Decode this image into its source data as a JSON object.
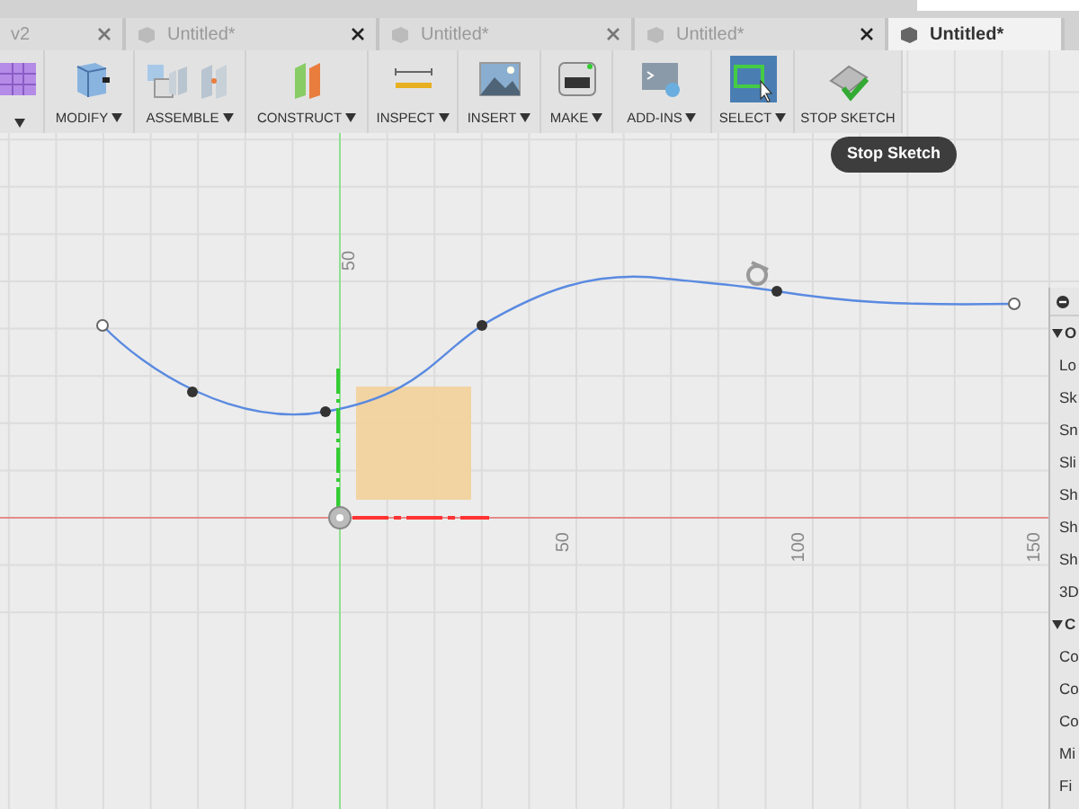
{
  "tabs": [
    {
      "label": "v2",
      "selected": false
    },
    {
      "label": "Untitled*",
      "selected": false
    },
    {
      "label": "Untitled*",
      "selected": false
    },
    {
      "label": "Untitled*",
      "selected": false
    },
    {
      "label": "Untitled*",
      "selected": true
    }
  ],
  "toolbar": [
    {
      "dropdown": true,
      "selected": false
    },
    {
      "label": "MODIFY",
      "dropdown": true,
      "selected": false
    },
    {
      "label": "ASSEMBLE",
      "dropdown": true,
      "selected": false
    },
    {
      "label": "CONSTRUCT",
      "dropdown": true,
      "selected": false
    },
    {
      "label": "INSPECT",
      "dropdown": true,
      "selected": false
    },
    {
      "label": "INSERT",
      "dropdown": true,
      "selected": false
    },
    {
      "label": "MAKE",
      "dropdown": true,
      "selected": false
    },
    {
      "label": "ADD-INS",
      "dropdown": true,
      "selected": false
    },
    {
      "label": "SELECT",
      "dropdown": true,
      "selected": true
    },
    {
      "label": "STOP SKETCH",
      "dropdown": false,
      "selected": false
    }
  ],
  "tooltip": "Stop Sketch",
  "canvas": {
    "y_axis_labels": [
      "50"
    ],
    "x_axis_labels": [
      "50",
      "100",
      "150"
    ]
  },
  "panel": {
    "sections": [
      {
        "title": "O",
        "expanded": true,
        "items": [
          "Lo",
          "Sk",
          "Sn",
          "Sli",
          "Sh",
          "Sh",
          "Sh",
          "3D"
        ]
      },
      {
        "title": "C",
        "expanded": true,
        "items": [
          "Co",
          "Co",
          "Co",
          "Mi",
          "Fi"
        ]
      }
    ]
  }
}
